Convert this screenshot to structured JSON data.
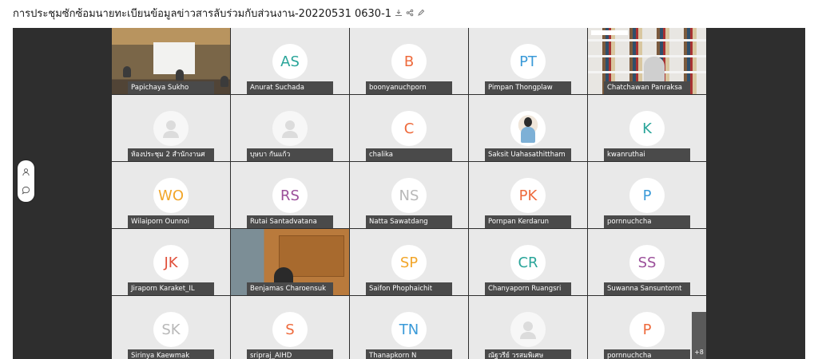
{
  "title": "การประชุมซักซ้อมนายทะเบียนข้อมูลข่าวสารลับร่วมกับส่วนงาน-20220531 0630-1",
  "title_icons": [
    "download-icon",
    "share-icon",
    "edit-icon"
  ],
  "side_controls": [
    "participants-icon",
    "chat-icon"
  ],
  "more_count": "+8",
  "participants": [
    {
      "name": "Papichaya Sukho",
      "type": "video",
      "scene": "room"
    },
    {
      "name": "Anurat Suchada",
      "type": "initials",
      "initials": "AS",
      "color": "#2aa59a"
    },
    {
      "name": "boonyanuchporn",
      "type": "initials",
      "initials": "B",
      "color": "#ee6a3c"
    },
    {
      "name": "Pimpan Thongplaw",
      "type": "initials",
      "initials": "PT",
      "color": "#3a9ad8"
    },
    {
      "name": "Chatchawan Panraksa",
      "type": "video",
      "scene": "books"
    },
    {
      "name": "ห้องประชุม 2 สำนักงานศ",
      "type": "placeholder"
    },
    {
      "name": "บุษบา กันแก้ว",
      "type": "placeholder"
    },
    {
      "name": "chalika",
      "type": "initials",
      "initials": "C",
      "color": "#ee6a3c"
    },
    {
      "name": "Saksit Uahasathittham",
      "type": "photo"
    },
    {
      "name": "kwanruthai",
      "type": "initials",
      "initials": "K",
      "color": "#2aa59a"
    },
    {
      "name": "Wilaiporn Ounnoi",
      "type": "initials",
      "initials": "WO",
      "color": "#f2a62a"
    },
    {
      "name": "Rutai Santadvatana",
      "type": "initials",
      "initials": "RS",
      "color": "#9b4f9a"
    },
    {
      "name": "Natta Sawatdang",
      "type": "initials",
      "initials": "NS",
      "color": "#b8b8b8"
    },
    {
      "name": "Pornpan Kerdarun",
      "type": "initials",
      "initials": "PK",
      "color": "#ee6a3c"
    },
    {
      "name": "pornnuchcha",
      "type": "initials",
      "initials": "P",
      "color": "#3a9ad8"
    },
    {
      "name": "Jiraporn Karaket_IL",
      "type": "initials",
      "initials": "JK",
      "color": "#e04f3a"
    },
    {
      "name": "Benjamas Charoensuk",
      "type": "video",
      "scene": "office"
    },
    {
      "name": "Saifon Phophaichit",
      "type": "initials",
      "initials": "SP",
      "color": "#f2a62a"
    },
    {
      "name": "Chanyaporn Ruangsri",
      "type": "initials",
      "initials": "CR",
      "color": "#2aa59a"
    },
    {
      "name": "Suwanna Sansuntornt",
      "type": "initials",
      "initials": "SS",
      "color": "#9b4f9a"
    },
    {
      "name": "Sirinya Kaewmak",
      "type": "initials",
      "initials": "SK",
      "color": "#b8b8b8"
    },
    {
      "name": "sripraj_AIHD",
      "type": "initials",
      "initials": "S",
      "color": "#ee6a3c"
    },
    {
      "name": "Thanapkorn N",
      "type": "initials",
      "initials": "TN",
      "color": "#3a9ad8"
    },
    {
      "name": "ณัฐวรีย์ วรสมพิเศษ",
      "type": "placeholder"
    },
    {
      "name": "pornnuchcha",
      "type": "initials",
      "initials": "P",
      "color": "#ee6a3c"
    }
  ]
}
